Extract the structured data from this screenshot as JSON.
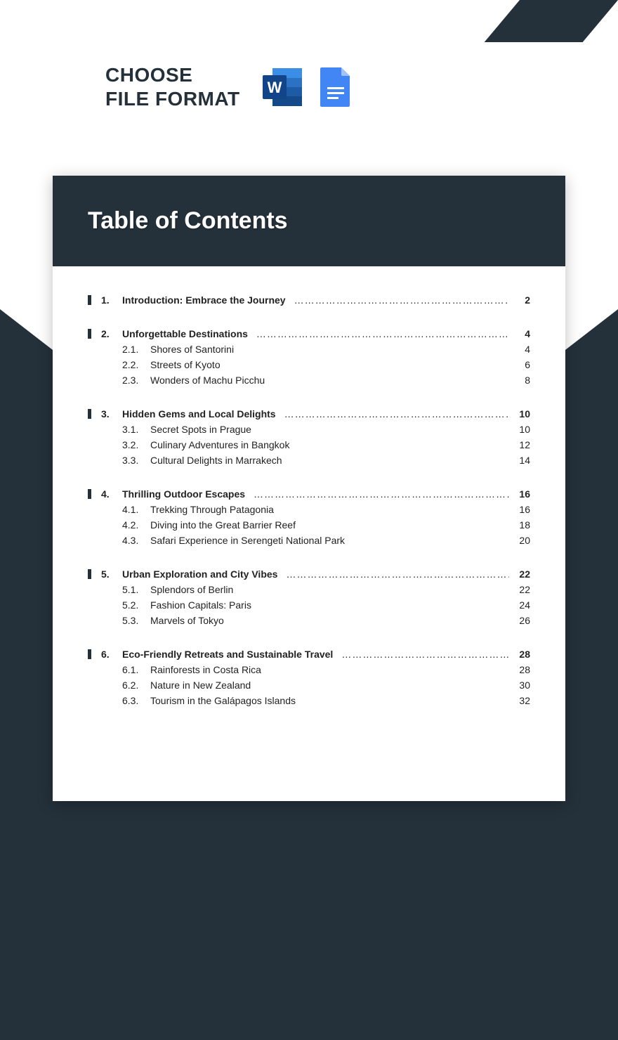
{
  "header": {
    "label_line1": "CHOOSE",
    "label_line2": "FILE FORMAT",
    "icons": [
      {
        "name": "word-icon"
      },
      {
        "name": "google-docs-icon"
      }
    ]
  },
  "page": {
    "title": "Table of Contents"
  },
  "toc": [
    {
      "num": "1.",
      "title": "Introduction: Embrace the Journey",
      "page": "2",
      "subs": []
    },
    {
      "num": "2.",
      "title": "Unforgettable Destinations",
      "page": "4",
      "subs": [
        {
          "num": "2.1.",
          "title": "Shores of Santorini",
          "page": "4"
        },
        {
          "num": "2.2.",
          "title": "Streets of Kyoto",
          "page": "6"
        },
        {
          "num": "2.3.",
          "title": "Wonders of Machu Picchu",
          "page": "8"
        }
      ]
    },
    {
      "num": "3.",
      "title": "Hidden Gems and Local Delights",
      "page": "10",
      "subs": [
        {
          "num": "3.1.",
          "title": "Secret Spots in Prague",
          "page": "10"
        },
        {
          "num": "3.2.",
          "title": "Culinary Adventures in Bangkok",
          "page": "12"
        },
        {
          "num": "3.3.",
          "title": "Cultural Delights in Marrakech",
          "page": "14"
        }
      ]
    },
    {
      "num": "4.",
      "title": "Thrilling Outdoor Escapes",
      "page": "16",
      "subs": [
        {
          "num": "4.1.",
          "title": "Trekking Through Patagonia",
          "page": "16"
        },
        {
          "num": "4.2.",
          "title": "Diving into the Great Barrier Reef",
          "page": "18"
        },
        {
          "num": "4.3.",
          "title": "Safari Experience in Serengeti National Park",
          "page": "20"
        }
      ]
    },
    {
      "num": "5.",
      "title": "Urban Exploration and City Vibes",
      "page": "22",
      "subs": [
        {
          "num": "5.1.",
          "title": "Splendors of Berlin",
          "page": "22"
        },
        {
          "num": "5.2.",
          "title": "Fashion Capitals: Paris",
          "page": "24"
        },
        {
          "num": "5.3.",
          "title": "Marvels of Tokyo",
          "page": "26"
        }
      ]
    },
    {
      "num": "6.",
      "title": "Eco-Friendly Retreats and Sustainable Travel",
      "page": "28",
      "subs": [
        {
          "num": "6.1.",
          "title": "Rainforests in Costa Rica",
          "page": "28"
        },
        {
          "num": "6.2.",
          "title": "Nature in New Zealand",
          "page": "30"
        },
        {
          "num": "6.3.",
          "title": "Tourism in the Galápagos Islands",
          "page": "32"
        }
      ]
    }
  ]
}
